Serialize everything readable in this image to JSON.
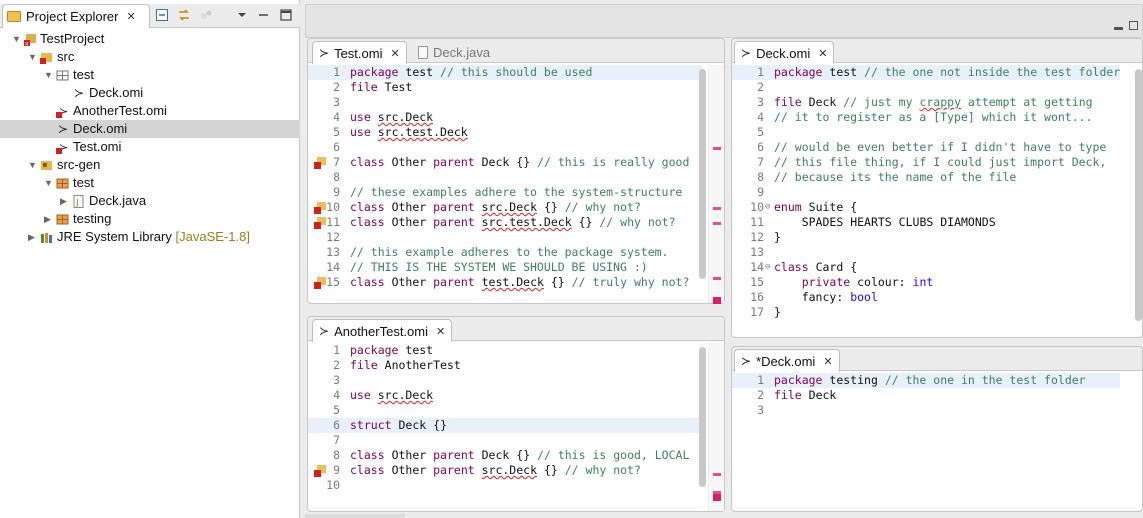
{
  "explorer": {
    "tab_label": "Project Explorer",
    "tree": [
      {
        "label": "TestProject",
        "icon": "project-error-icon"
      },
      {
        "label": "src",
        "icon": "source-folder-error-icon"
      },
      {
        "label": "test",
        "icon": "package-icon"
      },
      {
        "label": "Deck.omi",
        "icon": "omi-file-icon"
      },
      {
        "label": "AnotherTest.omi",
        "icon": "omi-file-error-icon"
      },
      {
        "label": "Deck.omi",
        "icon": "omi-file-icon"
      },
      {
        "label": "Test.omi",
        "icon": "omi-file-error-icon"
      },
      {
        "label": "src-gen",
        "icon": "source-folder-icon"
      },
      {
        "label": "test",
        "icon": "package-icon"
      },
      {
        "label": "Deck.java",
        "icon": "java-file-icon"
      },
      {
        "label": "testing",
        "icon": "package-icon"
      },
      {
        "label": "JRE System Library",
        "icon": "library-icon",
        "suffix": "[JavaSE-1.8]"
      }
    ]
  },
  "editors": {
    "test_omi": {
      "tab_active": "Test.omi",
      "tab_inactive": "Deck.java",
      "lines": [
        {
          "n": "1",
          "text": "package test // this should be used"
        },
        {
          "n": "2",
          "text": "file Test"
        },
        {
          "n": "3",
          "text": ""
        },
        {
          "n": "4",
          "text": "use src.Deck"
        },
        {
          "n": "5",
          "text": "use src.test.Deck"
        },
        {
          "n": "6",
          "text": ""
        },
        {
          "n": "7",
          "text": "class Other parent Deck {} // this is really good"
        },
        {
          "n": "8",
          "text": ""
        },
        {
          "n": "9",
          "text": "// these examples adhere to the system-structure"
        },
        {
          "n": "10",
          "text": "class Other parent src.Deck {} // why not?"
        },
        {
          "n": "11",
          "text": "class Other parent src.test.Deck {} // why not?"
        },
        {
          "n": "12",
          "text": ""
        },
        {
          "n": "13",
          "text": "// this example adheres to the package system."
        },
        {
          "n": "14",
          "text": "// THIS IS THE SYSTEM WE SHOULD BE USING :)"
        },
        {
          "n": "15",
          "text": "class Other parent test.Deck {} // truly why not?"
        }
      ]
    },
    "another_test_omi": {
      "tab_active": "AnotherTest.omi",
      "lines": [
        {
          "n": "1",
          "text": "package test"
        },
        {
          "n": "2",
          "text": "file AnotherTest"
        },
        {
          "n": "3",
          "text": ""
        },
        {
          "n": "4",
          "text": "use src.Deck"
        },
        {
          "n": "5",
          "text": ""
        },
        {
          "n": "6",
          "text": "struct Deck {}"
        },
        {
          "n": "7",
          "text": ""
        },
        {
          "n": "8",
          "text": "class Other parent Deck {} // this is good, LOCAL"
        },
        {
          "n": "9",
          "text": "class Other parent src.Deck {} // why not?"
        },
        {
          "n": "10",
          "text": ""
        }
      ]
    },
    "deck_omi": {
      "tab_active": "Deck.omi",
      "lines": [
        {
          "n": "1",
          "text": "package test // the one not inside the test folder"
        },
        {
          "n": "2",
          "text": ""
        },
        {
          "n": "3",
          "text": "file Deck // just my crappy attempt at getting"
        },
        {
          "n": "4",
          "text": "// it to register as a [Type] which it wont..."
        },
        {
          "n": "5",
          "text": ""
        },
        {
          "n": "6",
          "text": "// would be even better if I didn't have to type"
        },
        {
          "n": "7",
          "text": "// this file thing, if I could just import Deck,"
        },
        {
          "n": "8",
          "text": "// because its the name of the file"
        },
        {
          "n": "9",
          "text": ""
        },
        {
          "n": "10",
          "text": "enum Suite {"
        },
        {
          "n": "11",
          "text": "    SPADES HEARTS CLUBS DIAMONDS"
        },
        {
          "n": "12",
          "text": "}"
        },
        {
          "n": "13",
          "text": ""
        },
        {
          "n": "14",
          "text": "class Card {"
        },
        {
          "n": "15",
          "text": "    private colour: int"
        },
        {
          "n": "16",
          "text": "    fancy: bool"
        },
        {
          "n": "17",
          "text": "}"
        }
      ]
    },
    "deck_omi_testing": {
      "tab_active": "*Deck.omi",
      "lines": [
        {
          "n": "1",
          "text": "package testing // the one in the test folder"
        },
        {
          "n": "2",
          "text": "file Deck"
        },
        {
          "n": "3",
          "text": ""
        }
      ]
    }
  }
}
